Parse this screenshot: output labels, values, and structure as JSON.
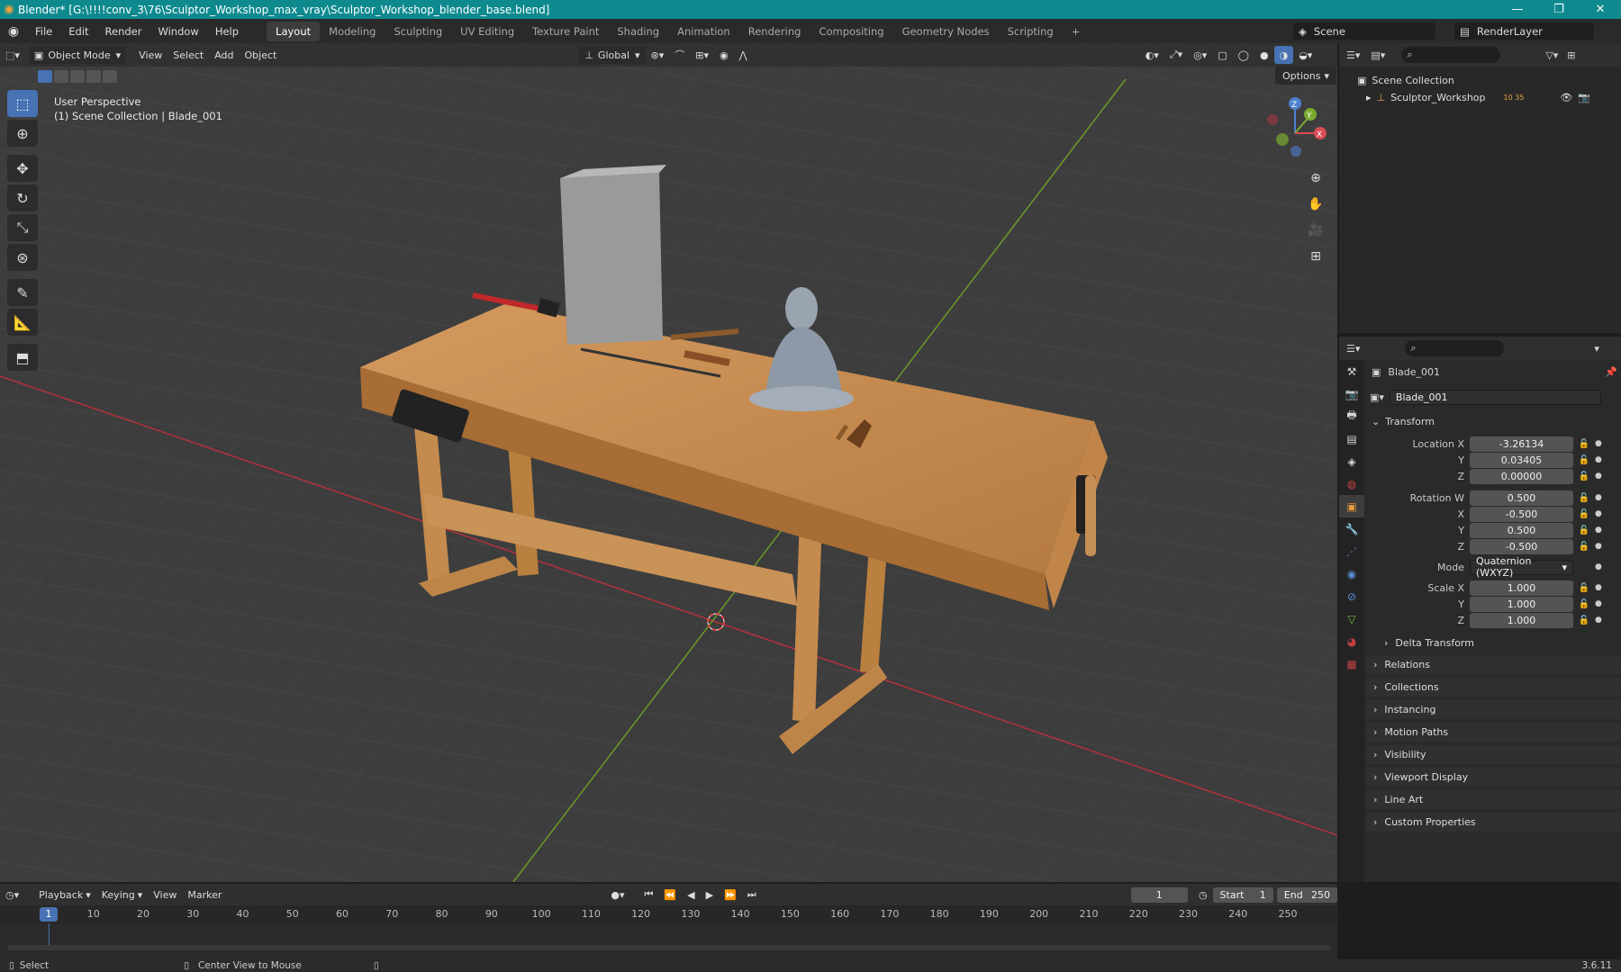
{
  "titlebar": {
    "title": "Blender* [G:\\!!!!conv_3\\76\\Sculptor_Workshop_max_vray\\Sculptor_Workshop_blender_base.blend]",
    "minimize": "—",
    "maximize": "❐",
    "close": "✕"
  },
  "menu": {
    "file": "File",
    "edit": "Edit",
    "render": "Render",
    "window": "Window",
    "help": "Help"
  },
  "workspaces": [
    "Layout",
    "Modeling",
    "Sculpting",
    "UV Editing",
    "Texture Paint",
    "Shading",
    "Animation",
    "Rendering",
    "Compositing",
    "Geometry Nodes",
    "Scripting",
    "+"
  ],
  "scene": {
    "name": "Scene",
    "view_layer": "RenderLayer"
  },
  "viewport": {
    "mode": "Object Mode",
    "menus": [
      "View",
      "Select",
      "Add",
      "Object"
    ],
    "orientation": "Global",
    "options": "Options",
    "perspective": "User Perspective",
    "collection_info": "(1) Scene Collection | Blade_001",
    "gizmo": {
      "z": "Z",
      "y": "Y",
      "x": "X"
    }
  },
  "outliner": {
    "root": "Scene Collection",
    "child": "Sculptor_Workshop",
    "child_badge": "10 35"
  },
  "properties": {
    "object_name": "Blade_001",
    "data_name": "Blade_001",
    "transform_header": "Transform",
    "location": {
      "label": "Location X",
      "x": "-3.26134",
      "y": "0.03405",
      "z": "0.00000"
    },
    "rotation": {
      "label": "Rotation W",
      "w": "0.500",
      "x": "-0.500",
      "y": "0.500",
      "z": "-0.500"
    },
    "mode_label": "Mode",
    "mode_value": "Quaternion (WXYZ)",
    "scale": {
      "label": "Scale X",
      "x": "1.000",
      "y": "1.000",
      "z": "1.000"
    },
    "axis_y": "Y",
    "axis_z": "Z",
    "axis_x": "X",
    "panels": [
      "Delta Transform",
      "Relations",
      "Collections",
      "Instancing",
      "Motion Paths",
      "Visibility",
      "Viewport Display",
      "Line Art",
      "Custom Properties"
    ]
  },
  "timeline": {
    "menus": [
      "Playback",
      "Keying",
      "View",
      "Marker"
    ],
    "current_frame": "1",
    "start_label": "Start",
    "start": "1",
    "end_label": "End",
    "end": "250",
    "ticks": [
      "1",
      "10",
      "20",
      "30",
      "40",
      "50",
      "60",
      "70",
      "80",
      "90",
      "100",
      "110",
      "120",
      "130",
      "140",
      "150",
      "160",
      "170",
      "180",
      "190",
      "200",
      "210",
      "220",
      "230",
      "240",
      "250"
    ]
  },
  "status": {
    "select": "Select",
    "center": "Center View to Mouse",
    "version": "3.6.11"
  },
  "colors": {
    "accent": "#4772b3",
    "titlebar": "#0e8a8f",
    "x_axis": "#b3323a",
    "y_axis": "#6c9a28"
  }
}
